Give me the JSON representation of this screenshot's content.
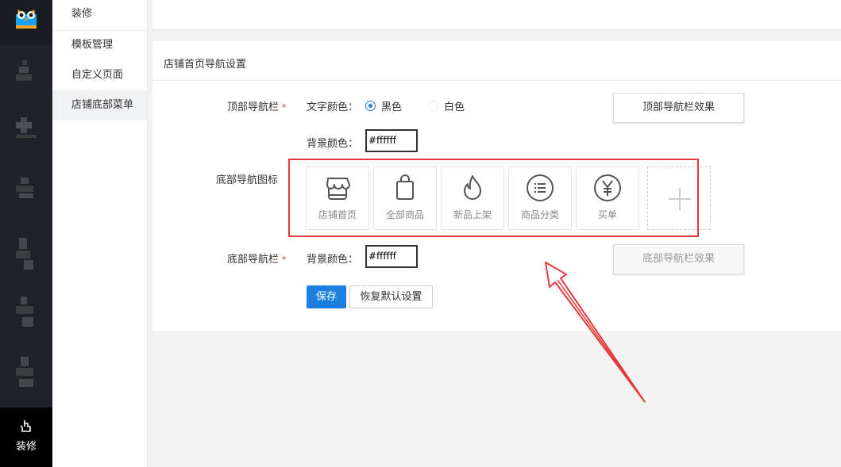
{
  "submenu": {
    "section": "装修",
    "items": [
      {
        "label": "模板管理"
      },
      {
        "label": "自定义页面"
      },
      {
        "label": "店铺底部菜单"
      }
    ]
  },
  "rail": {
    "active_label": "装修"
  },
  "panel": {
    "title": "店铺首页导航设置",
    "top_nav": {
      "label": "顶部导航栏",
      "text_color_label": "文字颜色：",
      "options": [
        "黑色",
        "白色"
      ],
      "selected": "黑色",
      "bg_color_label": "背景颜色：",
      "bg_color_value": "#ffffff",
      "effect_button": "顶部导航栏效果"
    },
    "bottom_icons": {
      "label": "底部导航图标",
      "items": [
        {
          "label": "店铺首页",
          "icon": "store-icon"
        },
        {
          "label": "全部商品",
          "icon": "bag-icon"
        },
        {
          "label": "新品上架",
          "icon": "flame-icon"
        },
        {
          "label": "商品分类",
          "icon": "list-circle-icon"
        },
        {
          "label": "买单",
          "icon": "yen-circle-icon"
        }
      ]
    },
    "bottom_nav": {
      "label": "底部导航栏",
      "bg_color_label": "背景颜色：",
      "bg_color_value": "#ffffff",
      "effect_button": "底部导航栏效果"
    },
    "actions": {
      "save": "保存",
      "reset": "恢复默认设置"
    }
  },
  "colors": {
    "accent": "#1b7fe0",
    "annotation_red": "#e4393c",
    "rail_bg": "#1f2228"
  }
}
